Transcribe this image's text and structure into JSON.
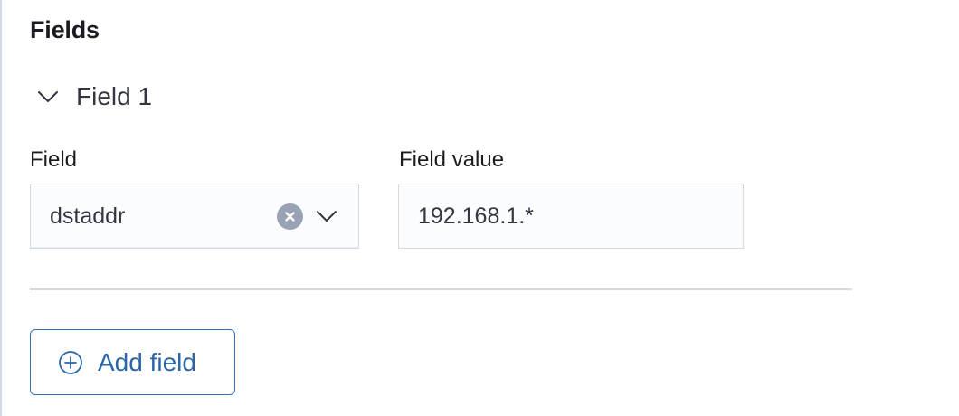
{
  "section": {
    "title": "Fields"
  },
  "accordion": {
    "label": "Field 1",
    "icon": "chevron-down-icon",
    "expanded": true
  },
  "form": {
    "field": {
      "label": "Field",
      "value": "dstaddr",
      "clear_icon": "clear-icon",
      "dropdown_icon": "chevron-down-icon"
    },
    "field_value": {
      "label": "Field value",
      "value": "192.168.1.*"
    }
  },
  "actions": {
    "add_field_label": "Add field",
    "add_icon": "plus-circle-icon"
  },
  "colors": {
    "primary": "#2965a8",
    "border": "#d3dae6",
    "input_bg": "#fbfcfd",
    "clear_icon_bg": "#98a2b3"
  }
}
